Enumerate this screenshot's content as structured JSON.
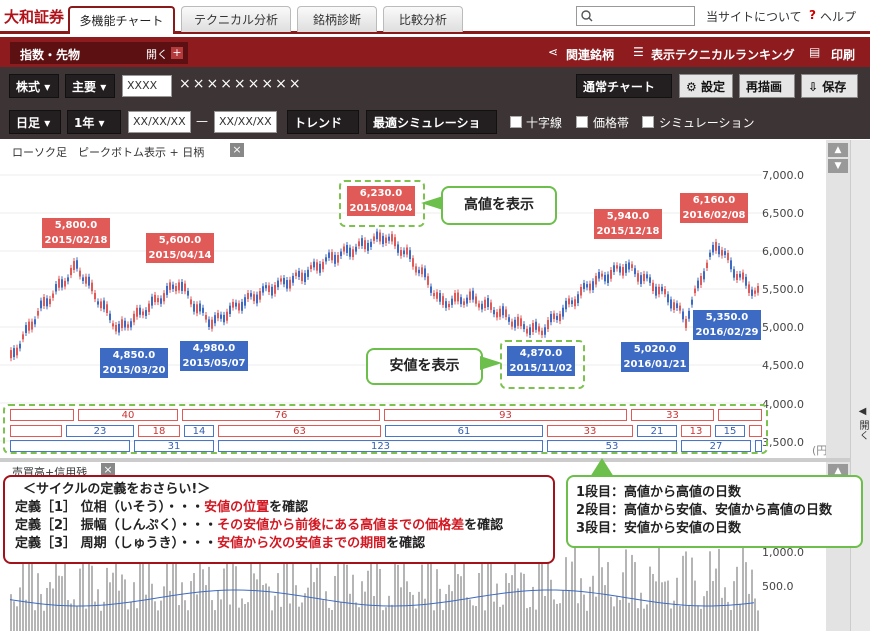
{
  "logo": "大和証券",
  "tabs": [
    {
      "label": "多機能チャート",
      "active": true
    },
    {
      "label": "テクニカル分析",
      "active": false
    },
    {
      "label": "銘柄診断",
      "active": false
    },
    {
      "label": "比較分析",
      "active": false
    }
  ],
  "search": {
    "placeholder": ""
  },
  "top_links": {
    "about": "当サイトについて",
    "help": "ヘルプ"
  },
  "band1": {
    "index_futures": "指数・先物",
    "open": "開く",
    "related": "関連銘柄",
    "ranking": "表示テクニカルランキング",
    "print": "印刷"
  },
  "band2": {
    "stock": "株式",
    "main": "主要",
    "code_value": "XXXX",
    "name": "×××××××××",
    "chart_type": "通常チャート",
    "settings": "設定",
    "redraw": "再描画",
    "save": "保存"
  },
  "band3": {
    "period_unit": "日足",
    "range": "1年",
    "date_from": "XX/XX/XX",
    "dash": "—",
    "date_to": "XX/XX/XX",
    "trendline": "トレンド線",
    "optimize_sim": "最適シミュレーション",
    "crosshair": "十字線",
    "price_band": "価格帯",
    "simulation": "シミュレーション"
  },
  "chart_panel": {
    "header": "ローソク足　ピークボトム表示 + 日柄",
    "volume_header": "売買高+信用残",
    "unit": "(円)",
    "side_open": "開く"
  },
  "price_axis": [
    "7,000.0",
    "6,500.0",
    "6,000.0",
    "5,500.0",
    "5,000.0",
    "4,500.0",
    "4,000.0",
    "3,500.0"
  ],
  "volume_axis": [
    "1,000.0",
    "500.0"
  ],
  "peaks": [
    {
      "price": "5,800.0",
      "date": "2015/02/18"
    },
    {
      "price": "5,600.0",
      "date": "2015/04/14"
    },
    {
      "price": "6,230.0",
      "date": "2015/08/04"
    },
    {
      "price": "5,940.0",
      "date": "2015/12/18"
    },
    {
      "price": "6,160.0",
      "date": "2016/02/08"
    }
  ],
  "troughs": [
    {
      "price": "4,850.0",
      "date": "2015/03/20"
    },
    {
      "price": "4,980.0",
      "date": "2015/05/07"
    },
    {
      "price": "4,870.0",
      "date": "2015/11/02"
    },
    {
      "price": "5,020.0",
      "date": "2016/01/21"
    },
    {
      "price": "5,350.0",
      "date": "2016/02/29"
    }
  ],
  "callouts": {
    "high": "高値を表示",
    "low": "安値を表示"
  },
  "cycle_rows": {
    "row1": [
      "40",
      "76",
      "93",
      "33"
    ],
    "row2": [
      "23",
      "18",
      "14",
      "63",
      "61",
      "33",
      "21",
      "13",
      "15"
    ],
    "row3": [
      "31",
      "123",
      "53",
      "27"
    ]
  },
  "definitions": {
    "title": "＜サイクルの定義をおさらい!＞",
    "def1_prefix": "定義［1］ 位相（いそう）・・・",
    "def1_red": "安値の位置",
    "def1_suffix": "を確認",
    "def2_prefix": "定義［2］ 振幅（しんぷく）・・・",
    "def2_red": "その安値から前後にある高値までの価格差",
    "def2_suffix": "を確認",
    "def3_prefix": "定義［3］ 周期（しゅうき）・・・",
    "def3_red": "安値から次の安値までの期間",
    "def3_suffix": "を確認"
  },
  "cycle_legend": {
    "line1": "1段目：高値から高値の日数",
    "line2": "2段目：高値から安値、安値から高値の日数",
    "line3": "3段目：安値から安値の日数"
  },
  "colors": {
    "brand": "#8e1b1e",
    "up": "#e05a58",
    "down": "#3d6bc4",
    "callout": "#6cbf4a"
  }
}
